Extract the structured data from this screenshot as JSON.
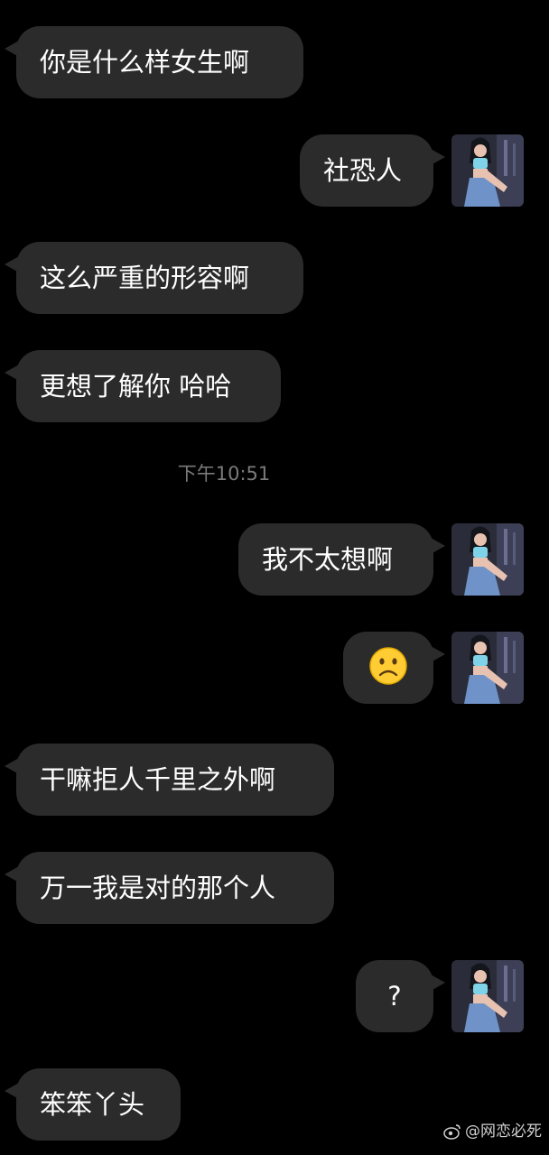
{
  "timestamp": "下午10:51",
  "messages": [
    {
      "side": "left",
      "text": "你是什么样女生啊"
    },
    {
      "side": "right",
      "text": "社恐人"
    },
    {
      "side": "left",
      "text": "这么严重的形容啊"
    },
    {
      "side": "left",
      "text": "更想了解你 哈哈"
    },
    {
      "side": "right",
      "text": "我不太想啊"
    },
    {
      "side": "right",
      "emoji": "frowning-face"
    },
    {
      "side": "left",
      "text": "干嘛拒人千里之外啊"
    },
    {
      "side": "left",
      "text": "万一我是对的那个人"
    },
    {
      "side": "right",
      "text": "?"
    },
    {
      "side": "left",
      "text": "笨笨丫头"
    }
  ],
  "watermark": {
    "text": "@网恋必死",
    "icon": "weibo-logo-icon"
  },
  "colors": {
    "background": "#000000",
    "bubble": "#2b2b2b",
    "text": "#ffffff",
    "timestamp": "#7a7a7a"
  }
}
